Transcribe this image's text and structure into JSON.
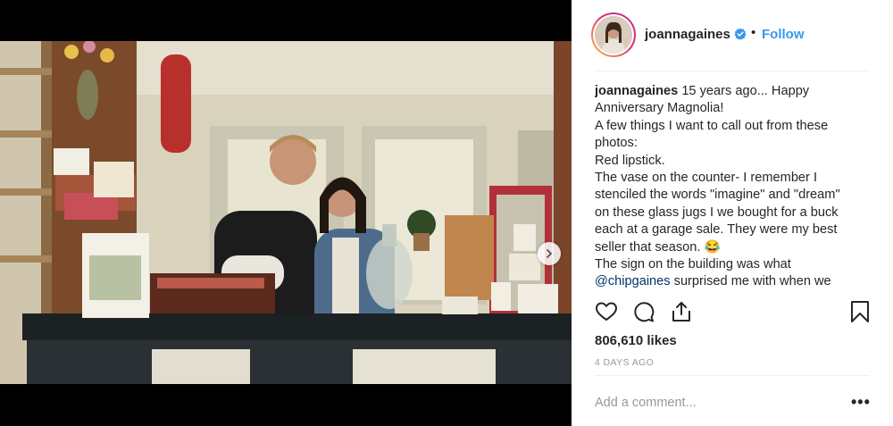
{
  "post": {
    "username": "joannagaines",
    "separator": "•",
    "follow_label": "Follow",
    "caption_lines": [
      {
        "user": "joannagaines",
        "text": " 15 years ago... Happy"
      },
      {
        "text": "Anniversary Magnolia!"
      },
      {
        "text": "A few things I want to call out from these"
      },
      {
        "text": "photos:"
      },
      {
        "text": "Red lipstick."
      },
      {
        "text": "The vase on the counter- I remember I"
      },
      {
        "text": "stenciled the words \"imagine\" and \"dream\""
      },
      {
        "text": "on these glass jugs I we bought for a buck"
      },
      {
        "text": "each at a garage sale. They were my best"
      },
      {
        "text": "seller that season. 😂"
      },
      {
        "text": "The sign on the building was what"
      },
      {
        "mention": "@chipgaines",
        "text": " surprised me with when we"
      }
    ],
    "likes": "806,610 likes",
    "timestamp": "4 DAYS AGO",
    "comment_placeholder": "Add a comment...",
    "more_label": "•••"
  },
  "colors": {
    "link_blue": "#3897f0",
    "mention": "#003569",
    "text": "#262626",
    "muted": "#999999",
    "verified": "#3897f0"
  },
  "icons": [
    "verified-badge-icon",
    "heart-icon",
    "comment-icon",
    "share-icon",
    "bookmark-icon",
    "chevron-right-icon",
    "more-options-icon"
  ]
}
